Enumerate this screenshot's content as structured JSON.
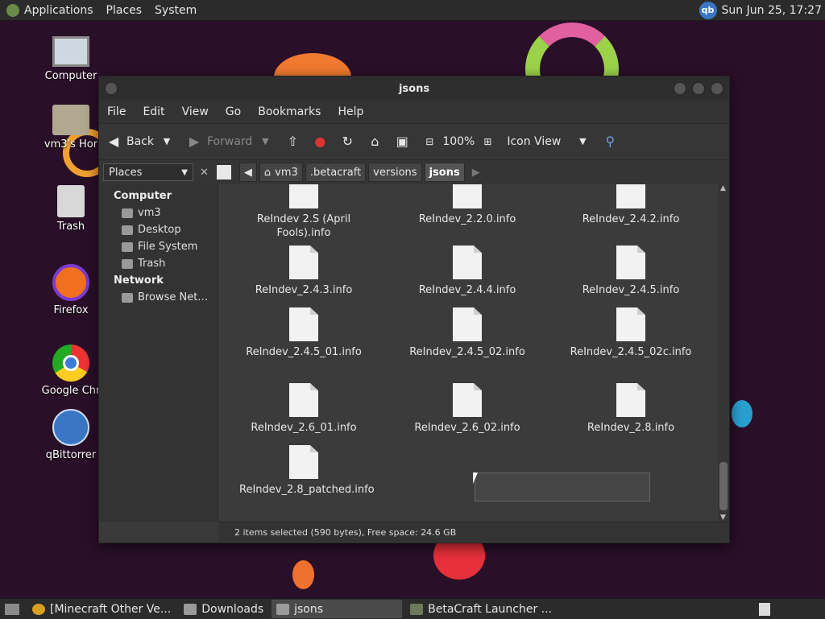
{
  "top_panel": {
    "menus": [
      "Applications",
      "Places",
      "System"
    ],
    "tray_icon": "qb",
    "clock": "Sun Jun 25, 17:27"
  },
  "desktop": {
    "icons": [
      {
        "label": "Computer",
        "icon": "computer-icon"
      },
      {
        "label": "vm3's Hor",
        "icon": "home-folder-icon"
      },
      {
        "label": "Trash",
        "icon": "trash-icon"
      },
      {
        "label": "Firefox",
        "icon": "firefox-icon"
      },
      {
        "label": "Google Chr",
        "icon": "chrome-icon"
      },
      {
        "label": "qBittorrer",
        "icon": "qbittorrent-icon"
      }
    ]
  },
  "window": {
    "title": "jsons",
    "menu": [
      "File",
      "Edit",
      "View",
      "Go",
      "Bookmarks",
      "Help"
    ],
    "toolbar": {
      "back": "Back",
      "forward": "Forward",
      "zoom": "100%",
      "view_mode": "Icon View"
    },
    "location": {
      "places_label": "Places",
      "crumbs": [
        "vm3",
        ".betacraft",
        "versions",
        "jsons"
      ]
    },
    "sidebar": {
      "computer_header": "Computer",
      "computer_items": [
        "vm3",
        "Desktop",
        "File System",
        "Trash"
      ],
      "network_header": "Network",
      "network_items": [
        "Browse Net…"
      ]
    },
    "files": [
      "ReIndev 2.S (April Fools).info",
      "ReIndev_2.2.0.info",
      "ReIndev_2.4.2.info",
      "ReIndev_2.4.3.info",
      "ReIndev_2.4.4.info",
      "ReIndev_2.4.5.info",
      "ReIndev_2.4.5_01.info",
      "ReIndev_2.4.5_02.info",
      "ReIndev_2.4.5_02c.info",
      "ReIndev_2.6_01.info",
      "ReIndev_2.6_02.info",
      "ReIndev_2.8.info",
      "ReIndev_2.8_patched.info"
    ],
    "status": "2 items selected (590 bytes), Free space: 24.6 GB"
  },
  "taskbar": {
    "items": [
      "[Minecraft Other Ve...",
      "Downloads",
      "jsons",
      "BetaCraft Launcher ..."
    ],
    "active_index": 2
  }
}
